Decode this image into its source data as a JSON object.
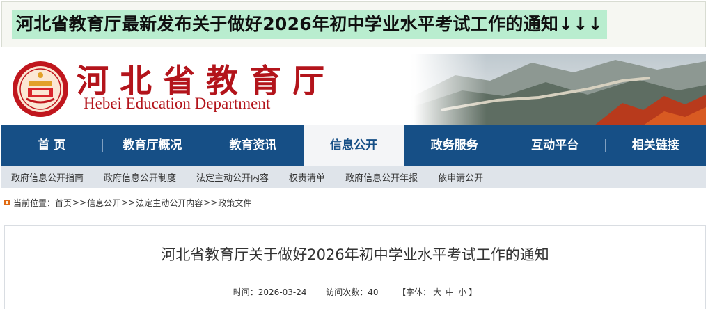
{
  "banner": {
    "title": "河北省教育厅最新发布关于做好2026年初中学业水平考试工作的通知↓↓↓"
  },
  "header": {
    "site_name_cn": "河北省教育厅",
    "site_name_en": "Hebei Education Department",
    "seal_icon": "department-seal-icon"
  },
  "colors": {
    "brand_red": "#b3141b",
    "nav_blue": "#164f86",
    "banner_highlight": "#b9edcf",
    "subnav_bg": "#dfe4ea"
  },
  "nav": {
    "items": [
      {
        "label": "首 页"
      },
      {
        "label": "教育厅概况"
      },
      {
        "label": "教育资讯"
      },
      {
        "label": "信息公开"
      },
      {
        "label": "政务服务"
      },
      {
        "label": "互动平台"
      },
      {
        "label": "相关链接"
      }
    ],
    "active": "信息公开"
  },
  "subnav": {
    "items": [
      {
        "label": "政府信息公开指南"
      },
      {
        "label": "政府信息公开制度"
      },
      {
        "label": "法定主动公开内容"
      },
      {
        "label": "权责清单"
      },
      {
        "label": "政府信息公开年报"
      },
      {
        "label": "依申请公开"
      }
    ]
  },
  "breadcrumb": {
    "prefix": "当前位置：",
    "items": [
      "首页",
      "信息公开",
      "法定主动公开内容",
      "政策文件"
    ],
    "separator": ">>"
  },
  "article": {
    "title": "河北省教育厅关于做好2026年初中学业水平考试工作的通知",
    "time_label": "时间：",
    "time_value": "2026-03-24",
    "views_label": "访问次数：",
    "views_value": "40",
    "font_open": "【字体：",
    "font_large": "大",
    "font_medium": "中",
    "font_small": "小",
    "font_close": "】"
  }
}
